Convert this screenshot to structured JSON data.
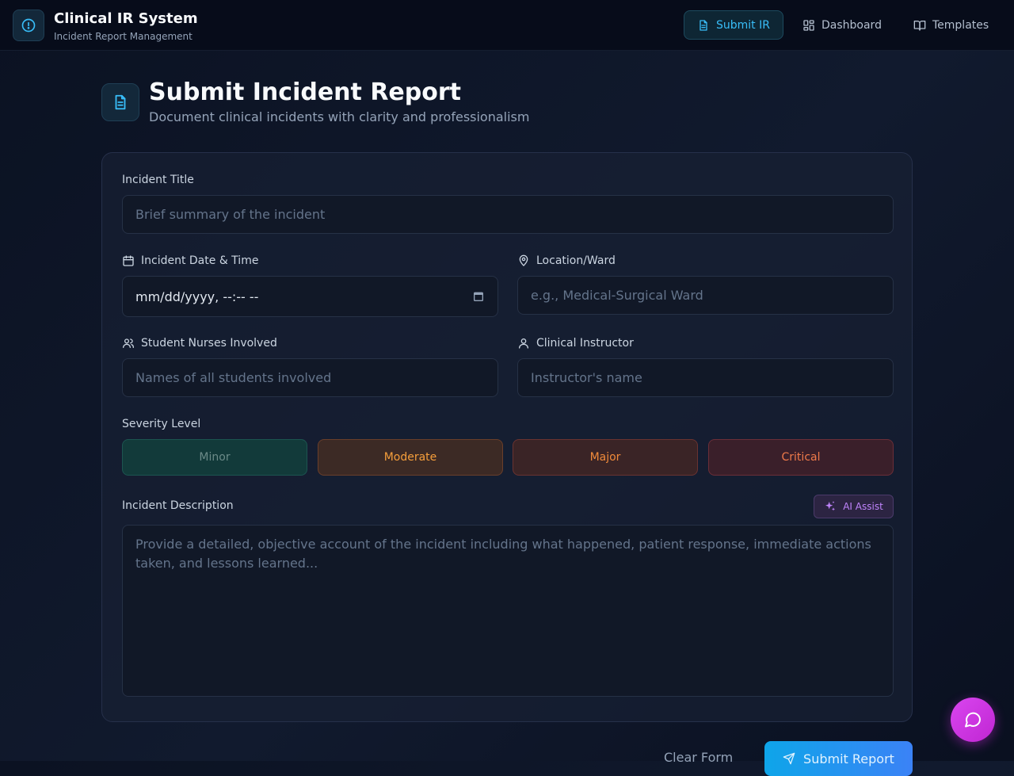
{
  "header": {
    "app_title": "Clinical IR System",
    "app_subtitle": "Incident Report Management",
    "logo_icon": "alert-circle-icon",
    "nav": [
      {
        "label": "Submit IR",
        "icon": "file-text-icon",
        "active": true
      },
      {
        "label": "Dashboard",
        "icon": "grid-icon",
        "active": false
      },
      {
        "label": "Templates",
        "icon": "book-open-icon",
        "active": false
      }
    ]
  },
  "page": {
    "title": "Submit Incident Report",
    "subtitle": "Document clinical incidents with clarity and professionalism",
    "icon": "file-text-icon"
  },
  "form": {
    "incident_title": {
      "label": "Incident Title",
      "placeholder": "Brief summary of the incident",
      "value": ""
    },
    "incident_datetime": {
      "label": "Incident Date & Time",
      "value": "mm/dd/yyyy, --:-- --",
      "icon": "calendar-icon"
    },
    "location": {
      "label": "Location/Ward",
      "placeholder": "e.g., Medical-Surgical Ward",
      "value": "",
      "icon": "map-pin-icon"
    },
    "students": {
      "label": "Student Nurses Involved",
      "placeholder": "Names of all students involved",
      "value": "",
      "icon": "users-icon"
    },
    "instructor": {
      "label": "Clinical Instructor",
      "placeholder": "Instructor's name",
      "value": "",
      "icon": "user-icon"
    },
    "severity": {
      "label": "Severity Level",
      "options": [
        "Minor",
        "Moderate",
        "Major",
        "Critical"
      ]
    },
    "description": {
      "label": "Incident Description",
      "placeholder": "Provide a detailed, objective account of the incident including what happened, patient response, immediate actions taken, and lessons learned...",
      "ai_assist_label": "AI Assist"
    },
    "clear_label": "Clear Form",
    "submit_label": "Submit Report"
  },
  "colors": {
    "accent": "#38bdf8",
    "minor": "#123a3a",
    "moderate": "#f59e3b",
    "major": "#f08a3a",
    "critical": "#ef7a4a",
    "ai": "#c084fc",
    "chat_fab": "#d946ef"
  }
}
